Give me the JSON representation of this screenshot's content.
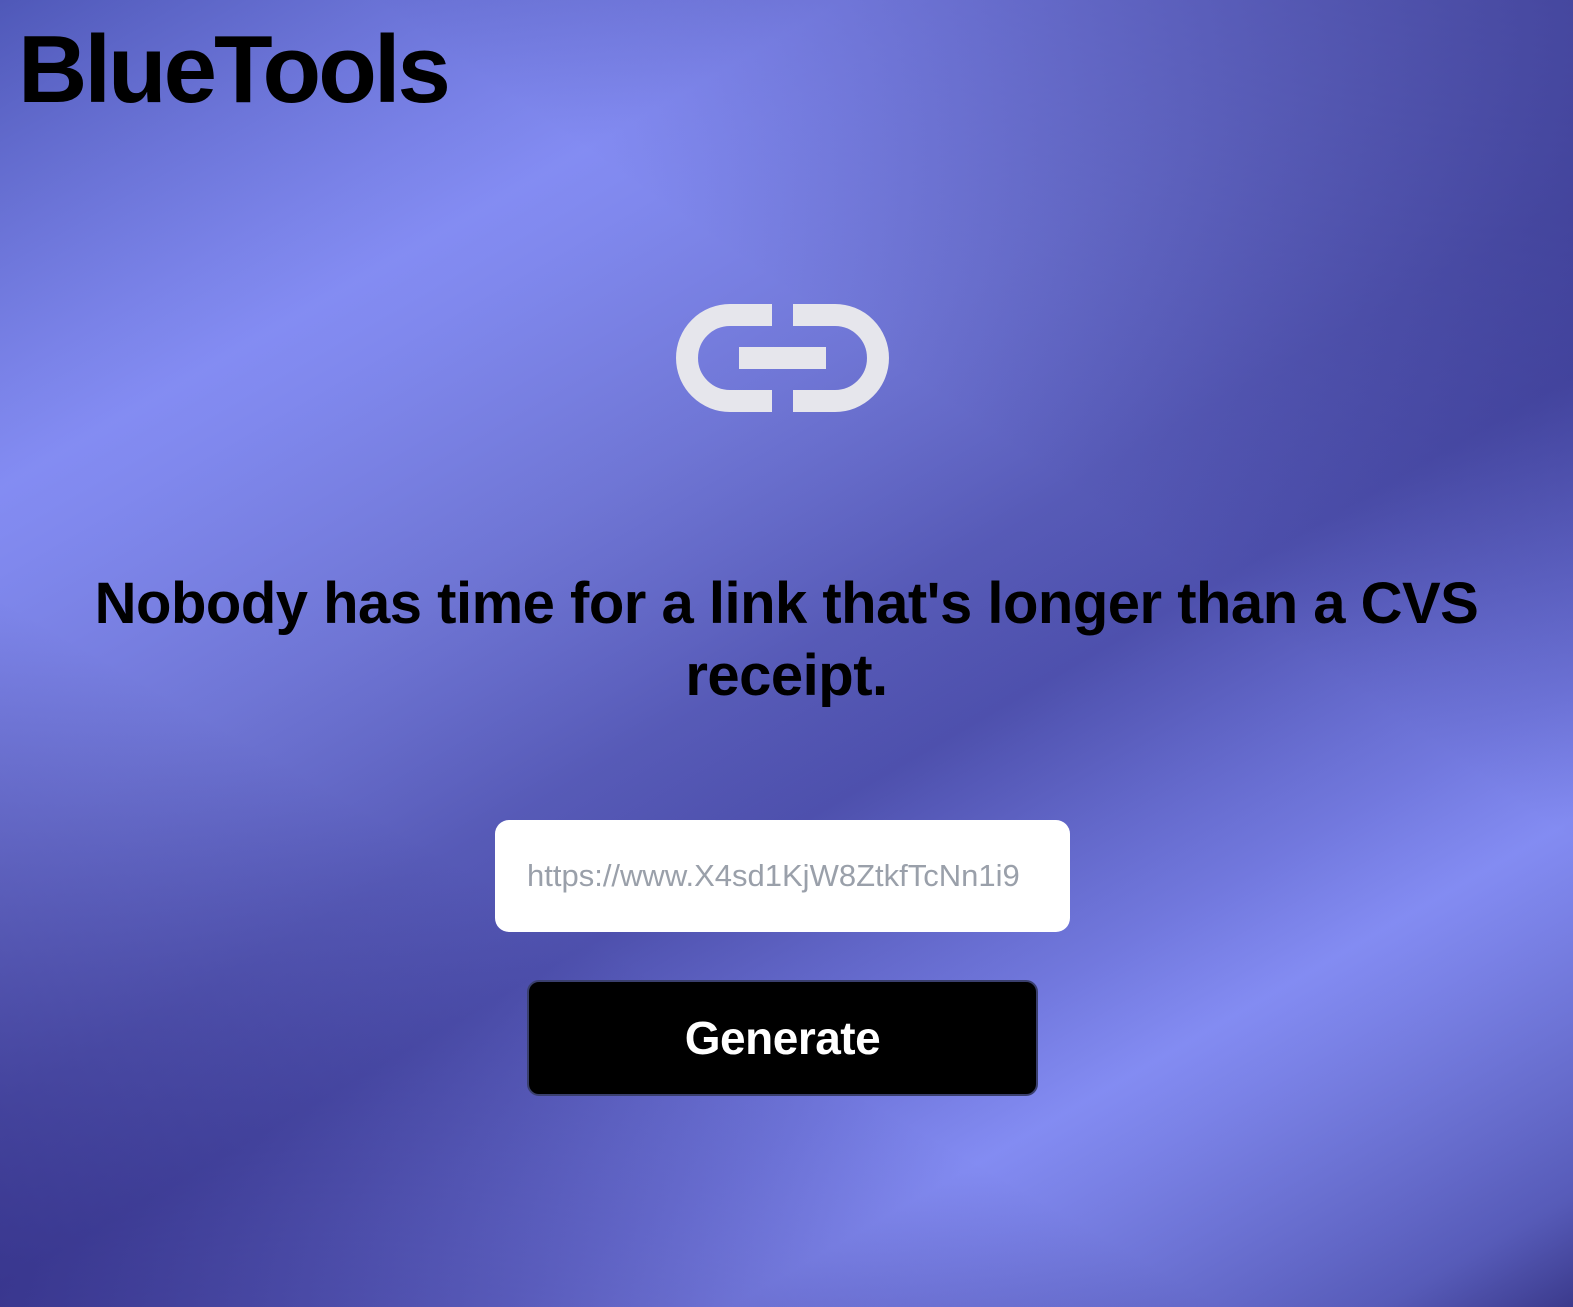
{
  "header": {
    "brand": "BlueTools"
  },
  "hero": {
    "icon": "link-icon",
    "headline": "Nobody has time for a link that's longer than a CVS receipt."
  },
  "form": {
    "url_placeholder": "https://www.X4sd1KjW8ZtkfTcNn1i9",
    "url_value": "",
    "generate_label": "Generate"
  },
  "colors": {
    "gradient_light": "#8189ef",
    "gradient_dark": "#3b3a8c",
    "icon": "#e6e6ec",
    "button_bg": "#000000",
    "button_text": "#ffffff"
  }
}
